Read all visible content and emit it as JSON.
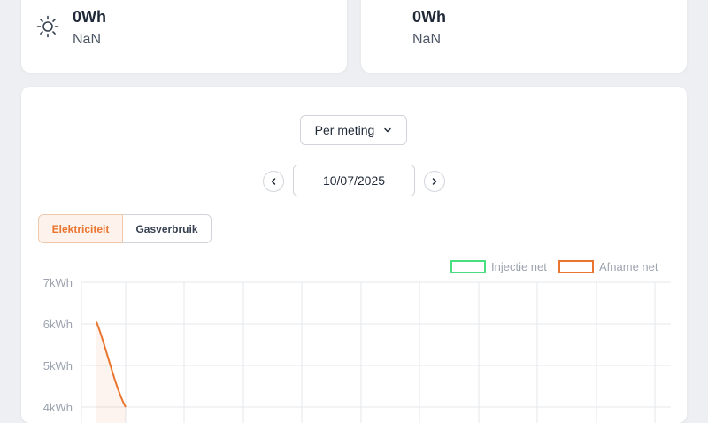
{
  "stats": {
    "solar": {
      "value": "0Wh",
      "sub": "NaN",
      "icon": "sun-icon"
    },
    "grid": {
      "value": "0Wh",
      "sub": "NaN"
    }
  },
  "controls": {
    "period_label": "Per meting",
    "date_value": "10/07/2025",
    "tabs": [
      {
        "label": "Elektriciteit",
        "active": true
      },
      {
        "label": "Gasverbruik",
        "active": false
      }
    ]
  },
  "colors": {
    "injection": "#4ade80",
    "consumption": "#e9752f",
    "accent": "#e9752f"
  },
  "chart_data": {
    "type": "line",
    "yticks": [
      "7kWh",
      "6kWh",
      "5kWh",
      "4kWh"
    ],
    "ylim_visible": [
      4,
      7
    ],
    "legend_position": "top-right",
    "grid": true,
    "series": [
      {
        "name": "Injectie net",
        "values": []
      },
      {
        "name": "Afname net",
        "values": [
          6.05,
          4.0
        ]
      }
    ]
  }
}
